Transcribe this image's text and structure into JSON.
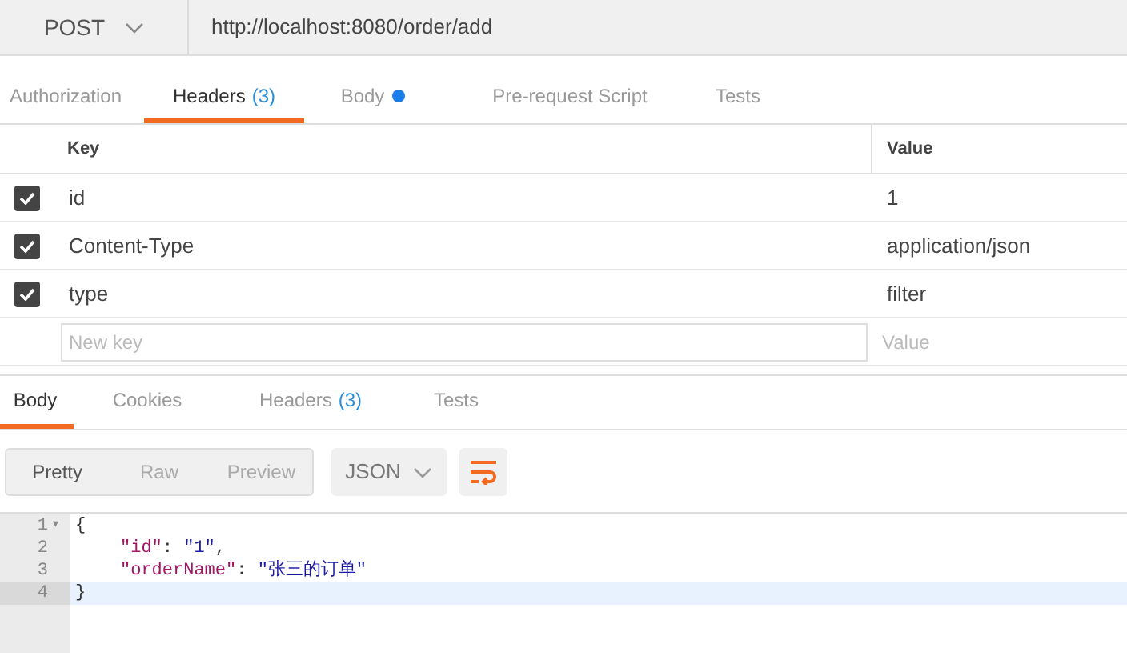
{
  "request": {
    "method": "POST",
    "url": "http://localhost:8080/order/add"
  },
  "request_tabs": [
    {
      "label": "Authorization",
      "selected": false
    },
    {
      "label": "Headers",
      "count": "(3)",
      "selected": true
    },
    {
      "label": "Body",
      "dot": true,
      "selected": false
    },
    {
      "label": "Pre-request Script",
      "selected": false
    },
    {
      "label": "Tests",
      "selected": false
    }
  ],
  "headers_table": {
    "columns": [
      "Key",
      "Value"
    ],
    "rows": [
      {
        "key": "id",
        "value": "1",
        "checked": true
      },
      {
        "key": "Content-Type",
        "value": "application/json",
        "checked": true
      },
      {
        "key": "type",
        "value": "filter",
        "checked": true
      }
    ],
    "new_row": {
      "key_placeholder": "New key",
      "value_placeholder": "Value"
    }
  },
  "response_tabs": [
    {
      "label": "Body",
      "selected": true
    },
    {
      "label": "Cookies",
      "selected": false
    },
    {
      "label": "Headers",
      "count": "(3)",
      "selected": false
    },
    {
      "label": "Tests",
      "selected": false
    }
  ],
  "view_modes": [
    {
      "label": "Pretty",
      "selected": true
    },
    {
      "label": "Raw",
      "selected": false
    },
    {
      "label": "Preview",
      "selected": false
    }
  ],
  "format": "JSON",
  "editor": {
    "lines": [
      {
        "number": "1",
        "fold": "▾",
        "tokens": [
          {
            "kind": "punct",
            "text": "{"
          }
        ]
      },
      {
        "number": "2",
        "tokens": [
          {
            "kind": "key",
            "text": "\"id\""
          },
          {
            "kind": "punct",
            "text": ": "
          },
          {
            "kind": "string",
            "text": "\"1\""
          },
          {
            "kind": "punct",
            "text": ","
          }
        ]
      },
      {
        "number": "3",
        "tokens": [
          {
            "kind": "key",
            "text": "\"orderName\""
          },
          {
            "kind": "punct",
            "text": ": "
          },
          {
            "kind": "string",
            "text": "\"张三的订单\""
          }
        ]
      },
      {
        "number": "4",
        "current": true,
        "tokens": [
          {
            "kind": "punct",
            "text": "}"
          }
        ]
      }
    ]
  }
}
